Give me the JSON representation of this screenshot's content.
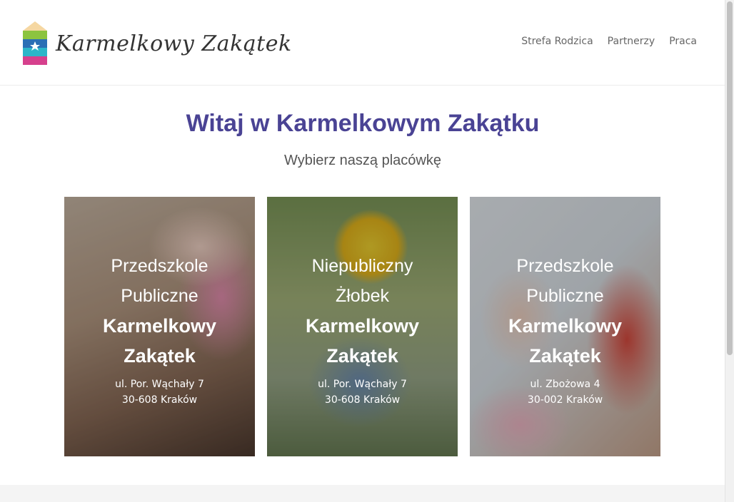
{
  "header": {
    "logo_text": "Karmelkowy Zakątek",
    "nav": [
      "Strefa Rodzica",
      "Partnerzy",
      "Praca"
    ]
  },
  "hero": {
    "title": "Witaj w Karmelkowym Zakątku",
    "subtitle": "Wybierz naszą placówkę"
  },
  "cards": [
    {
      "line1": "Przedszkole",
      "line2": "Publiczne",
      "name1": "Karmelkowy",
      "name2": "Zakątek",
      "address1": "ul. Por. Wąchały 7",
      "address2": "30-608 Kraków"
    },
    {
      "line1": "Niepubliczny",
      "line2": "Żłobek",
      "name1": "Karmelkowy",
      "name2": "Zakątek",
      "address1": "ul. Por. Wąchały 7",
      "address2": "30-608 Kraków"
    },
    {
      "line1": "Przedszkole",
      "line2": "Publiczne",
      "name1": "Karmelkowy",
      "name2": "Zakątek",
      "address1": "ul. Zbożowa 4",
      "address2": "30-002 Kraków"
    }
  ],
  "colors": {
    "title": "#4a4394",
    "nav": "#666666"
  }
}
